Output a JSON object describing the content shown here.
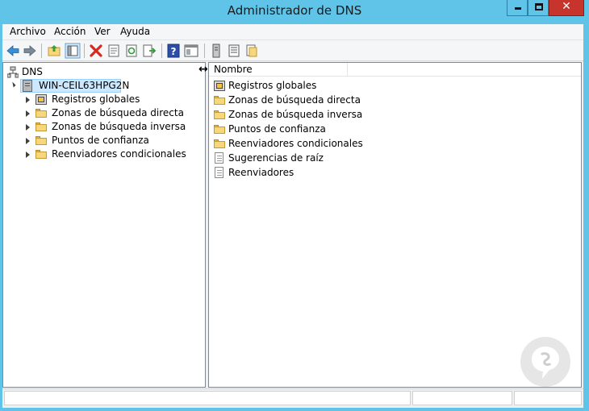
{
  "window": {
    "title": "Administrador de DNS",
    "controls": {
      "minimize": "minimize",
      "maximize": "maximize",
      "close": "✕"
    }
  },
  "menu": [
    "Archivo",
    "Acción",
    "Ver",
    "Ayuda"
  ],
  "toolbar": {
    "icons": [
      "back-arrow-icon",
      "forward-arrow-icon",
      "up-folder-icon",
      "show-hide-tree-icon",
      "delete-icon",
      "properties-icon",
      "refresh-icon",
      "export-list-icon",
      "help-icon",
      "mmc-pane-icon",
      "server-icon",
      "list-icon",
      "folder-icon"
    ]
  },
  "tree": {
    "root": "DNS",
    "server": "WIN-CEIL63HPG2N",
    "children": [
      "Registros globales",
      "Zonas de búsqueda directa",
      "Zonas de búsqueda inversa",
      "Puntos de confianza",
      "Reenviadores condicionales"
    ]
  },
  "list": {
    "column": "Nombre",
    "items": [
      {
        "label": "Registros globales",
        "icon": "globe-zone-icon"
      },
      {
        "label": "Zonas de búsqueda directa",
        "icon": "folder-icon"
      },
      {
        "label": "Zonas de búsqueda inversa",
        "icon": "folder-icon"
      },
      {
        "label": "Puntos de confianza",
        "icon": "folder-icon"
      },
      {
        "label": "Reenviadores condicionales",
        "icon": "folder-icon"
      },
      {
        "label": "Sugerencias de raíz",
        "icon": "document-icon"
      },
      {
        "label": "Reenviadores",
        "icon": "document-icon"
      }
    ]
  },
  "colors": {
    "title_bar": "#5fc4e8",
    "close_button": "#c7342b",
    "selection": "#cce8ff"
  }
}
